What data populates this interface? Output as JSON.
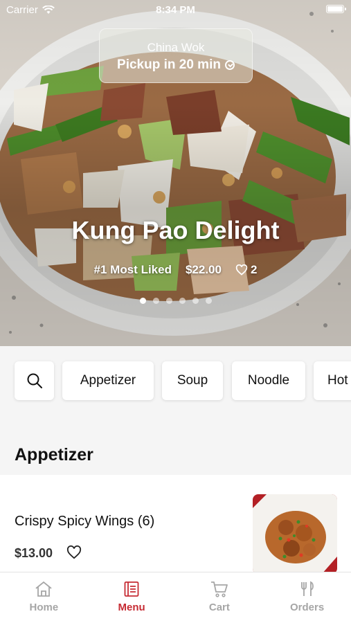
{
  "status_bar": {
    "carrier": "Carrier",
    "time": "8:34 PM"
  },
  "store": {
    "name": "China Wok",
    "pickup": "Pickup in 20 min"
  },
  "hero": {
    "title": "Kung Pao Delight",
    "badge": "#1 Most Liked",
    "price": "$22.00",
    "likes": "2",
    "slide_count": 6,
    "active_slide": 0
  },
  "categories": [
    "Appetizer",
    "Soup",
    "Noodle",
    "Hot"
  ],
  "section": {
    "title": "Appetizer"
  },
  "items": [
    {
      "name": "Crispy Spicy Wings (6)",
      "price": "$13.00"
    }
  ],
  "tabs": [
    {
      "label": "Home",
      "icon": "home-icon",
      "active": false
    },
    {
      "label": "Menu",
      "icon": "menu-icon",
      "active": true
    },
    {
      "label": "Cart",
      "icon": "cart-icon",
      "active": false
    },
    {
      "label": "Orders",
      "icon": "orders-icon",
      "active": false
    }
  ],
  "colors": {
    "accent": "#c62b33",
    "inactive": "#a6a6a6"
  }
}
